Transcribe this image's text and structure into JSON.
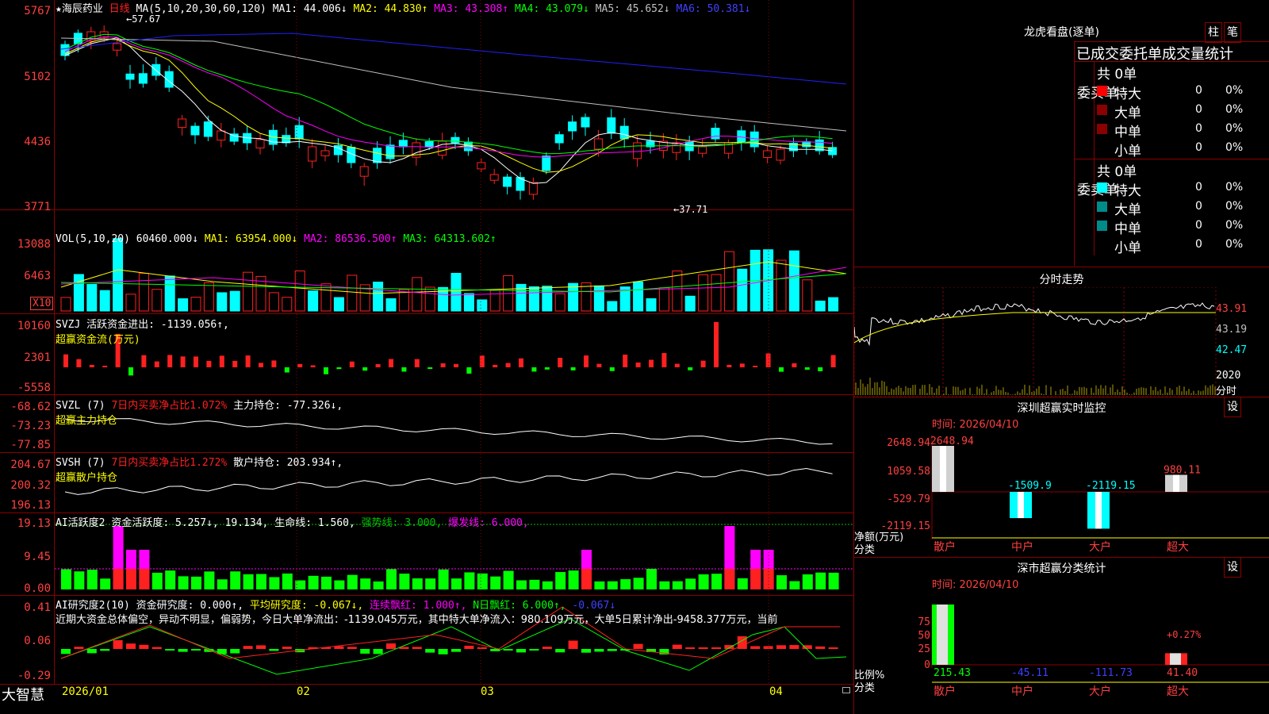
{
  "chart": {
    "stock_name": "海辰药业",
    "period_label": "日线",
    "ma_legend": [
      "MA(5,10,20,30,60,120)",
      "MA1: 44.006↓",
      "MA2: 44.830↑",
      "MA3: 43.308↑",
      "MA4: 43.079↓",
      "MA5: 45.652↓",
      "MA6: 50.381↓"
    ],
    "ma_colors": [
      "#ffffff",
      "#ffff00",
      "#ff00ff",
      "#00ff00",
      "#c0c0c0",
      "#0000ff"
    ],
    "price_axis": [
      "5767",
      "5102",
      "4436",
      "3771"
    ],
    "high_label": "57.67",
    "low_label": "37.71",
    "vol_legend": {
      "title": "VOL(5,10,20)",
      "vol": "60460.000↓",
      "ma1": "MA1: 63954.000↓",
      "ma2": "MA2: 86536.500↑",
      "ma3": "MA3: 64313.602↑"
    },
    "vol_axis": [
      "13088",
      "6463"
    ],
    "vol_unit": "X10",
    "svzj": {
      "title": "SVZJ",
      "text": "活跃资金进出: -1139.056↑,",
      "sub": "超赢资金流(万元)"
    },
    "svzj_axis": [
      "10160",
      "2301",
      "-5558"
    ],
    "svzl": {
      "title": "SVZL (7)",
      "ratio": "7日内买卖净占比1.072%",
      "hold": "主力持仓: -77.326↓,",
      "sub": "超赢主力持仓"
    },
    "svzl_axis": [
      "-68.62",
      "-73.23",
      "-77.85"
    ],
    "svsh": {
      "title": "SVSH (7)",
      "ratio": "7日内买卖净占比1.272%",
      "hold": "散户持仓: 203.934↑,",
      "sub": "超赢散户持仓"
    },
    "svsh_axis": [
      "204.67",
      "200.32",
      "196.13"
    ],
    "ai1": {
      "title": "AI活跃度2",
      "text": "资金活跃度: 5.257↓, 19.134, 生命线: 1.560,",
      "strong": "强势线: 3.000,",
      "burst": "爆发线: 6.000,"
    },
    "ai1_axis": [
      "19.13",
      "9.45",
      "0.00"
    ],
    "ai2": {
      "title": "AI研究度2(10)",
      "text": "资金研究度: 0.000↑,",
      "avg": "平均研究度: -0.067↓,",
      "streak": "连续飘红: 1.000↑,",
      "nday": "N日飘红: 6.000↑,",
      "last": "-0.067↓"
    },
    "ai2_comment": "近期大资金总体偏空，异动不明显，偏弱势，今日大单净流出：-1139.045万元，其中特大单净流入：980.109万元，大单5日累计净出-9458.377万元，当前",
    "ai2_axis": [
      "0.41",
      "0.06",
      "-0.29"
    ],
    "date_labels": [
      "2026/01",
      "02",
      "03",
      "04"
    ],
    "brand": "大智慧"
  },
  "dragon": {
    "title": "龙虎看盘(逐单)",
    "btn_bar": "柱",
    "btn_pen": "笔",
    "stats_title": "已成交委托单成交量统计",
    "buy_label": "委买单",
    "sell_label": "委卖单",
    "buy_total": "共 0单",
    "sell_total": "共 0单",
    "buy_rows": [
      {
        "name": "特大",
        "count": "0",
        "pct": "0%"
      },
      {
        "name": "大单",
        "count": "0",
        "pct": "0%"
      },
      {
        "name": "中单",
        "count": "0",
        "pct": "0%"
      },
      {
        "name": "小单",
        "count": "0",
        "pct": "0%"
      }
    ],
    "sell_rows": [
      {
        "name": "特大",
        "count": "0",
        "pct": "0%"
      },
      {
        "name": "大单",
        "count": "0",
        "pct": "0%"
      },
      {
        "name": "中单",
        "count": "0",
        "pct": "0%"
      },
      {
        "name": "小单",
        "count": "0",
        "pct": "0%"
      }
    ],
    "buy_colors": [
      "#ff0000",
      "#8b0000",
      "#8b0000",
      "#000000"
    ],
    "sell_colors": [
      "#00ffff",
      "#008b8b",
      "#008b8b",
      "#000000"
    ]
  },
  "intraday": {
    "title": "分时走势",
    "axis": [
      "43.91",
      "43.19",
      "42.47",
      "2020"
    ],
    "time_label": "分时"
  },
  "sz_monitor": {
    "title": "深圳超赢实时监控",
    "set_btn": "设",
    "time": "时间: 2026/04/10",
    "axis": [
      "2648.94",
      "1059.58",
      "-529.79",
      "-2119.15"
    ],
    "ylabel1": "净额(万元)",
    "ylabel2": "分类",
    "bars": [
      {
        "name": "散户",
        "value": 2648.94,
        "label": "2648.94"
      },
      {
        "name": "中户",
        "value": -1509.9,
        "label": "-1509.9"
      },
      {
        "name": "大户",
        "value": -2119.15,
        "label": "-2119.15"
      },
      {
        "name": "超大",
        "value": 980.11,
        "label": "980.11"
      }
    ]
  },
  "sz_class": {
    "title": "深市超赢分类统计",
    "set_btn": "设",
    "time": "时间: 2026/04/10",
    "axis": [
      "75",
      "50",
      "25",
      "0"
    ],
    "ylabel1": "比例%",
    "ylabel2": "分类",
    "bars": [
      {
        "name": "散户",
        "value": 215.43,
        "label": "215.43"
      },
      {
        "name": "中户",
        "value": -45.11,
        "label": "-45.11"
      },
      {
        "name": "大户",
        "value": -111.73,
        "label": "-111.73"
      },
      {
        "name": "超大",
        "value": 41.4,
        "label": "41.40",
        "pct": "+0.27%"
      }
    ]
  }
}
